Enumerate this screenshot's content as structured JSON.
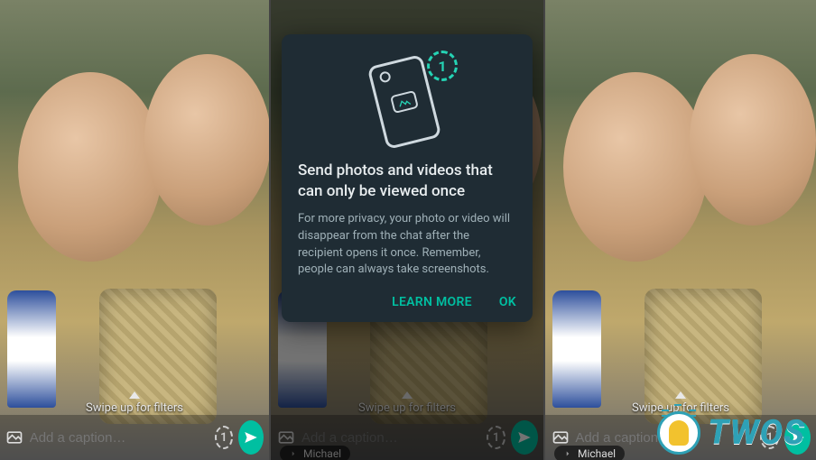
{
  "hint_text": "Swipe up for filters",
  "caption": {
    "placeholder": "Add a caption…",
    "value": "",
    "recipient": "Michael"
  },
  "view_once_badge": "1",
  "dialog": {
    "illustration_badge": "1",
    "title": "Send photos and videos that can only be viewed once",
    "body": "For more privacy, your photo or video will disappear from the chat after the recipient opens it once. Remember, people can always take screenshots.",
    "learn_more_label": "LEARN MORE",
    "ok_label": "OK"
  },
  "watermark": {
    "text": "TWOS"
  },
  "colors": {
    "accent": "#00bfa1",
    "dialog_bg": "#1f2c34",
    "logo": "#2ea1b6"
  }
}
